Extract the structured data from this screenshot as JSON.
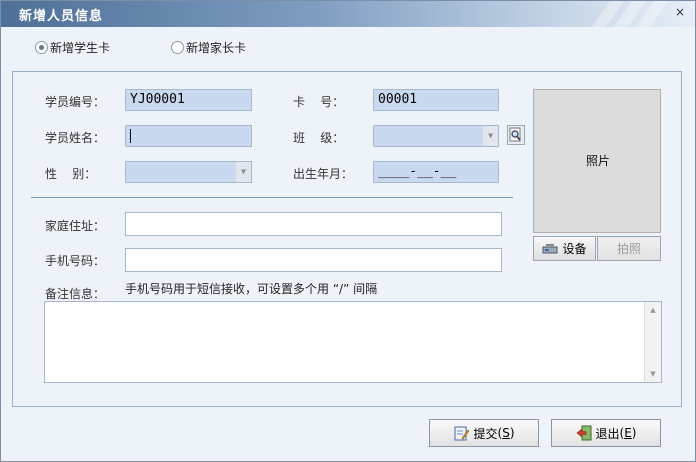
{
  "window": {
    "title": "新增人员信息",
    "close_glyph": "×"
  },
  "card_type": {
    "options": [
      {
        "label": "新增学生卡",
        "checked": true
      },
      {
        "label": "新增家长卡",
        "checked": false
      }
    ]
  },
  "form": {
    "student_no": {
      "label": "学员编号：",
      "value": "YJ00001"
    },
    "card_no": {
      "label": "卡    号：",
      "value": "00001"
    },
    "name": {
      "label": "学员姓名：",
      "value": ""
    },
    "class": {
      "label": "班    级：",
      "value": ""
    },
    "gender": {
      "label": "性    别：",
      "value": ""
    },
    "birth": {
      "label": "出生年月：",
      "value": "____-__-__"
    },
    "address": {
      "label": "家庭住址：",
      "value": ""
    },
    "phone": {
      "label": "手机号码：",
      "value": ""
    },
    "remark": {
      "label": "备注信息：",
      "hint": "手机号码用于短信接收，可设置多个用 “/” 间隔",
      "value": ""
    }
  },
  "photo": {
    "label": "照片",
    "device_label": "设备",
    "capture_label": "拍照"
  },
  "actions": {
    "submit_label": "提交",
    "submit_hotkey": "S",
    "exit_label": "退出",
    "exit_hotkey": "E"
  },
  "icons": {
    "search": "search-icon",
    "device": "device-icon",
    "submit": "submit-icon",
    "exit": "exit-icon"
  },
  "colors": {
    "title_bar": "#4d6f98",
    "field_fill": "#c9daf0",
    "divider": "#7a9cbf"
  }
}
